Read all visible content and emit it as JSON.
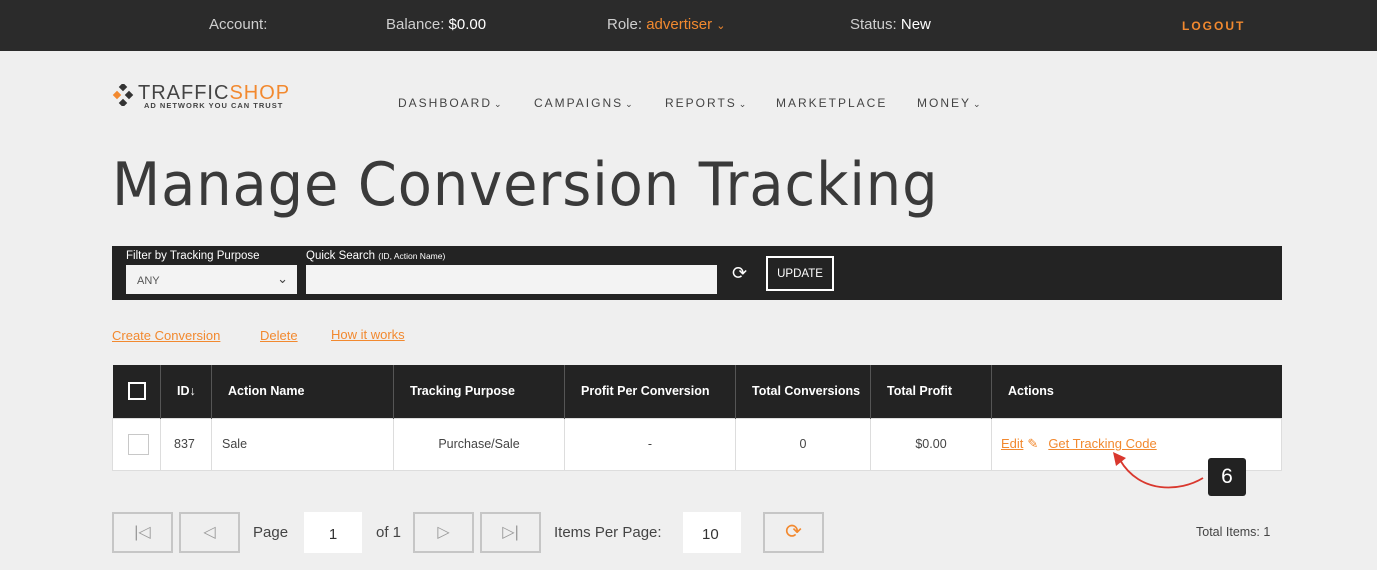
{
  "topbar": {
    "account_label": "Account:",
    "balance_label": "Balance:",
    "balance_value": "$0.00",
    "role_label": "Role:",
    "role_value": "advertiser",
    "status_label": "Status:",
    "status_value": "New",
    "logout": "LOGOUT"
  },
  "logo": {
    "name_a": "TRAFFIC",
    "name_b": "SHOP",
    "tagline": "AD NETWORK YOU CAN TRUST"
  },
  "nav": [
    {
      "label": "DASHBOARD",
      "dropdown": true
    },
    {
      "label": "CAMPAIGNS",
      "dropdown": true
    },
    {
      "label": "REPORTS",
      "dropdown": true
    },
    {
      "label": "MARKETPLACE",
      "dropdown": false
    },
    {
      "label": "MONEY",
      "dropdown": true
    }
  ],
  "page_title": "Manage Conversion Tracking",
  "filter": {
    "purpose_label": "Filter by Tracking Purpose",
    "purpose_value": "ANY",
    "search_label": "Quick Search",
    "search_hint": "(ID, Action Name)",
    "search_value": "",
    "update_label": "UPDATE"
  },
  "links": {
    "create": "Create Conversion",
    "delete": "Delete",
    "how": "How it works"
  },
  "table": {
    "headers": [
      "ID",
      "Action Name",
      "Tracking Purpose",
      "Profit Per Conversion",
      "Total Conversions",
      "Total Profit",
      "Actions"
    ],
    "sort_indicator": "↓",
    "rows": [
      {
        "id": "837",
        "action_name": "Sale",
        "purpose": "Purchase/Sale",
        "profit_per": "-",
        "total_conv": "0",
        "total_profit": "$0.00",
        "edit": "Edit",
        "tracking": "Get Tracking Code"
      }
    ]
  },
  "annotation": {
    "badge": "6"
  },
  "pagination": {
    "page_label": "Page",
    "page_value": "1",
    "of_label": "of 1",
    "items_label": "Items Per Page:",
    "items_value": "10",
    "total_label": "Total Items:",
    "total_value": "1"
  },
  "colors": {
    "accent": "#f2892f",
    "dark": "#232323",
    "background": "#efefef"
  }
}
